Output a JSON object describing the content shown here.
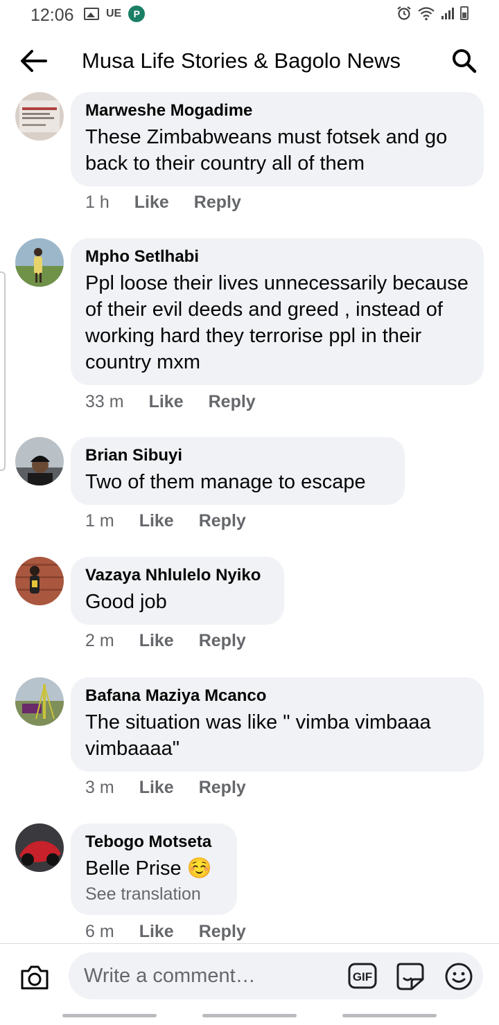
{
  "status_bar": {
    "time": "12:06",
    "carrier_label": "UE",
    "icons": [
      "gallery-icon",
      "ue-icon",
      "parking-app-icon",
      "alarm-icon",
      "wifi-icon",
      "signal-icon",
      "battery-icon"
    ]
  },
  "header": {
    "title": "Musa Life Stories & Bagolo News",
    "icons": [
      "back-arrow-icon",
      "search-icon"
    ]
  },
  "comments": [
    {
      "author": "Marweshe Mogadime",
      "text": "These Zimbabweans must fotsek and go back to their country all of them",
      "time": "1 h",
      "like": "Like",
      "reply": "Reply"
    },
    {
      "author": "Mpho Setlhabi",
      "text": "Ppl loose their lives unnecessarily because of their evil deeds and greed , instead of working hard they terrorise ppl in their country mxm",
      "time": "33 m",
      "like": "Like",
      "reply": "Reply"
    },
    {
      "author": "Brian Sibuyi",
      "text": "Two of them manage to escape",
      "time": "1 m",
      "like": "Like",
      "reply": "Reply"
    },
    {
      "author": "Vazaya Nhlulelo Nyiko",
      "text": "Good job",
      "time": "2 m",
      "like": "Like",
      "reply": "Reply"
    },
    {
      "author": "Bafana Maziya Mcanco",
      "text": "The situation was like \" vimba vimbaaa vimbaaaa\"",
      "time": "3 m",
      "like": "Like",
      "reply": "Reply"
    },
    {
      "author": "Tebogo Motseta",
      "text": "Belle Prise ☺️",
      "translation_link": "See translation",
      "time": "6 m",
      "like": "Like",
      "reply": "Reply"
    }
  ],
  "composer": {
    "placeholder": "Write a comment…",
    "icons": [
      "camera-icon",
      "gif-icon",
      "sticker-icon",
      "emoji-icon"
    ]
  },
  "colors": {
    "bubble_background": "#f0f2f5",
    "meta_text": "#65676b",
    "primary_text": "#050505"
  }
}
